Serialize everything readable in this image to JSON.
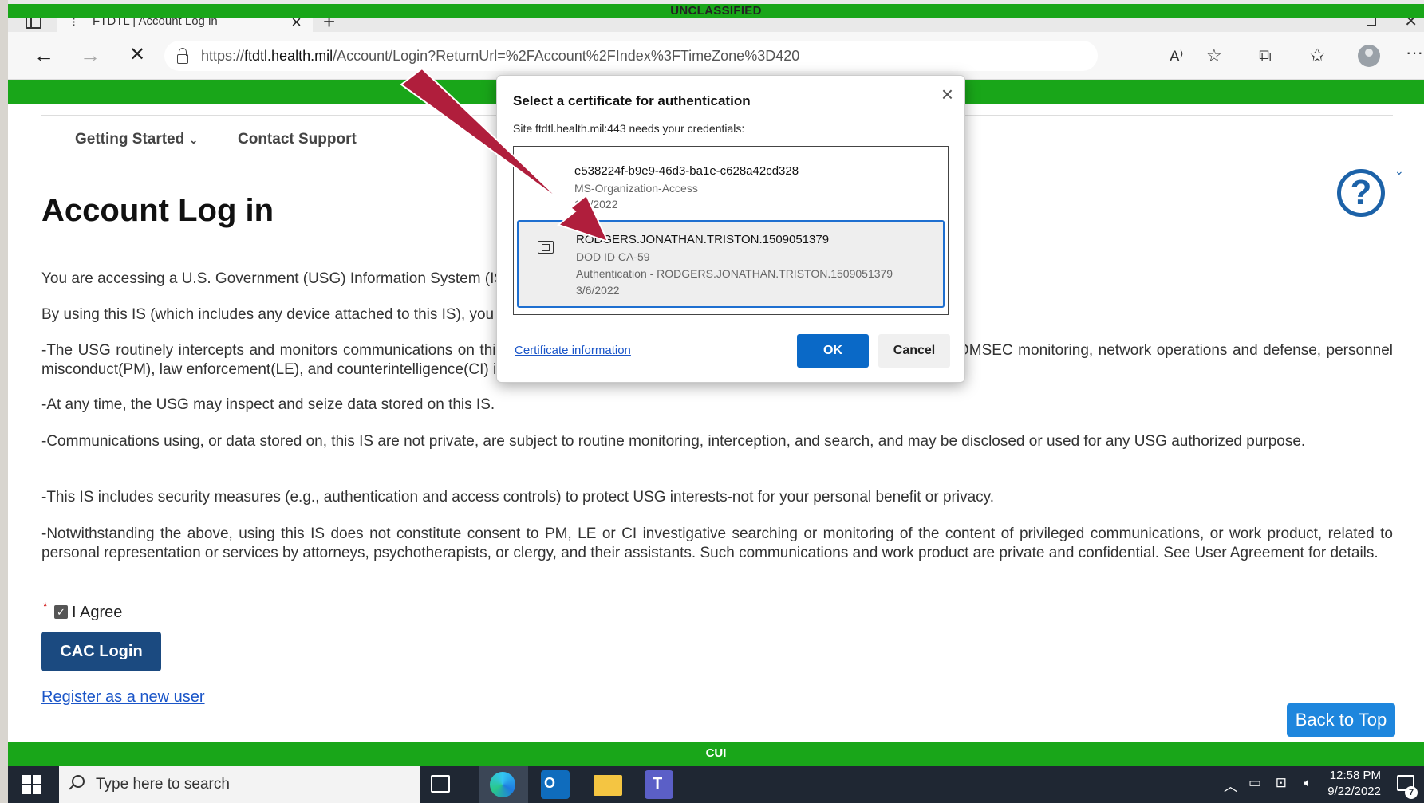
{
  "classification_top": "UNCLASSIFIED",
  "classification_bottom": "CUI",
  "browser": {
    "tab_title": "FTDTL | Account Log in",
    "url_prefix": "https://",
    "url_host": "ftdtl.health.mil",
    "url_path": "/Account/Login?ReturnUrl=%2FAccount%2FIndex%3FTimeZone%3D420"
  },
  "nav": {
    "getting_started": "Getting Started",
    "contact_support": "Contact Support"
  },
  "page": {
    "title": "Account Log in",
    "paragraphs": [
      "You are accessing a U.S. Government (USG) Information System (IS) that is provided for USG-authorized use only.",
      "By using this IS (which includes any device attached to this IS), you consent to the following conditions:",
      "-The USG routinely intercepts and monitors communications on this IS for purposes including, but not limited to, penetration testing, COMSEC monitoring, network operations and defense, personnel misconduct(PM), law enforcement(LE), and counterintelligence(CI) investigations.",
      "-At any time, the USG may inspect and seize data stored on this IS.",
      "-Communications using, or data stored on, this IS are not private, are subject to routine monitoring, interception, and search, and may be disclosed or used for any USG authorized purpose.",
      "-This IS includes security measures (e.g., authentication and access controls) to protect USG interests-not for your personal benefit or privacy.",
      "-Notwithstanding the above, using this IS does not constitute consent to PM, LE or CI investigative searching or monitoring of the content of privileged communications, or work product, related to personal representation or services by attorneys, psychotherapists, or clergy, and their assistants. Such communications and work product are private and confidential. See User Agreement for details."
    ],
    "agree_label": "I Agree",
    "cac_login": "CAC Login",
    "register_link": "Register as a new user",
    "back_to_top": "Back to Top"
  },
  "dialog": {
    "title": "Select a certificate for authentication",
    "subtitle": "Site ftdtl.health.mil:443 needs your credentials:",
    "certificates": [
      {
        "name": "e538224f-b9e9-46d3-ba1e-c628a42cd328",
        "issuer": "MS-Organization-Access",
        "date": "1/4/2022"
      },
      {
        "name": "RODGERS.JONATHAN.TRISTON.1509051379",
        "issuer": "DOD ID CA-59",
        "purpose": "Authentication - RODGERS.JONATHAN.TRISTON.1509051379",
        "date": "3/6/2022",
        "selected": true
      }
    ],
    "cert_info_link": "Certificate information",
    "ok": "OK",
    "cancel": "Cancel"
  },
  "taskbar": {
    "search_placeholder": "Type here to search",
    "time": "12:58 PM",
    "date": "9/22/2022",
    "notification_count": "7"
  },
  "colors": {
    "classification_green": "#19a619",
    "cac_button": "#1b4a80",
    "ok_button": "#0a69c7",
    "arrow": "#b01e3c"
  }
}
